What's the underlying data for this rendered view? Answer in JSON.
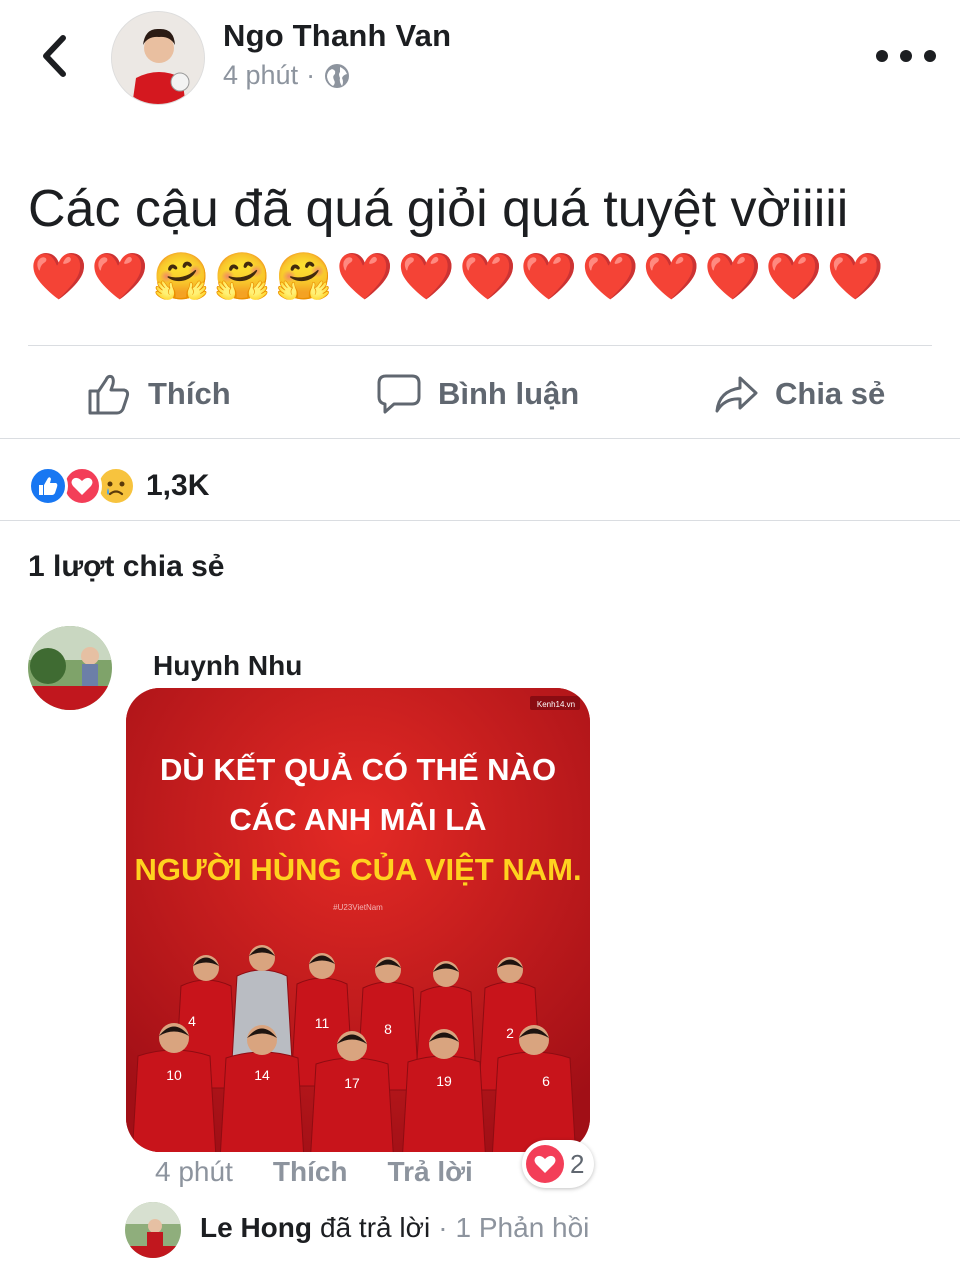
{
  "post": {
    "author_name": "Ngo Thanh Van",
    "time": "4 phút",
    "separator": "·",
    "text": "Các cậu đã quá giỏi quá tuyệt vờiiiii",
    "emoji_sequence": [
      "❤️",
      "❤️",
      "🤗",
      "🤗",
      "🤗",
      "❤️",
      "❤️",
      "❤️",
      "❤️",
      "❤️",
      "❤️",
      "❤️",
      "❤️",
      "❤️"
    ]
  },
  "actions": {
    "like_label": "Thích",
    "comment_label": "Bình luận",
    "share_label": "Chia sẻ"
  },
  "reactions": {
    "types": [
      "like",
      "love",
      "sad"
    ],
    "count": "1,3K"
  },
  "shares": {
    "label": "1 lượt chia sẻ"
  },
  "comment": {
    "author_name": "Huynh Nhu",
    "image": {
      "watermark": "Kenh14.vn",
      "line1": "DÙ KẾT QUẢ CÓ THẾ NÀO",
      "line2": "CÁC ANH MÃI LÀ",
      "line3": "NGƯỜI HÙNG CỦA VIỆT NAM.",
      "hashtag": "#U23VietNam",
      "jersey_numbers": [
        "4",
        "11",
        "8",
        "2",
        "10",
        "14",
        "17",
        "19",
        "6"
      ]
    },
    "time": "4 phút",
    "like_label": "Thích",
    "reply_label": "Trả lời",
    "reaction_count": "2"
  },
  "reply": {
    "author_name": "Le Hong",
    "action_text": "đã trả lời",
    "separator": "·",
    "replies_text": "1 Phản hồi"
  },
  "colors": {
    "facebook_blue": "#1877f2",
    "love_red": "#f33e58",
    "sad_yellow": "#f7c33e",
    "poster_red": "#c1171e",
    "poster_yellow": "#ffd21f",
    "muted_text": "#8d949e"
  }
}
